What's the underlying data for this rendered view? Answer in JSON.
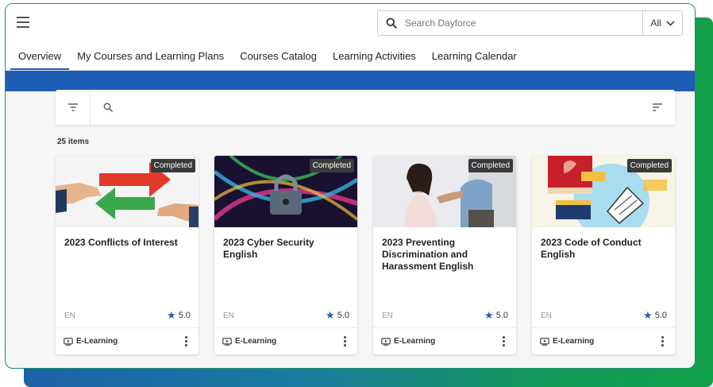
{
  "search": {
    "placeholder": "Search Dayforce",
    "scope": "All"
  },
  "tabs": [
    {
      "label": "Overview",
      "active": true
    },
    {
      "label": "My Courses and Learning Plans"
    },
    {
      "label": "Courses Catalog"
    },
    {
      "label": "Learning Activities"
    },
    {
      "label": "Learning Calendar"
    }
  ],
  "results": {
    "count_label": "25 items"
  },
  "cards": [
    {
      "title": "2023 Conflicts of Interest",
      "status": "Completed",
      "language": "EN",
      "rating": "5.0",
      "type": "E-Learning"
    },
    {
      "title": "2023 Cyber Security English",
      "status": "Completed",
      "language": "EN",
      "rating": "5.0",
      "type": "E-Learning"
    },
    {
      "title": "2023 Preventing Discrimination and Harassment English",
      "status": "Completed",
      "language": "EN",
      "rating": "5.0",
      "type": "E-Learning"
    },
    {
      "title": "2023 Code of Conduct English",
      "status": "Completed",
      "language": "EN",
      "rating": "5.0",
      "type": "E-Learning"
    }
  ],
  "colors": {
    "brand_blue": "#1e5fb5",
    "accent_green": "#12a14a",
    "star": "#1e5fb5"
  }
}
